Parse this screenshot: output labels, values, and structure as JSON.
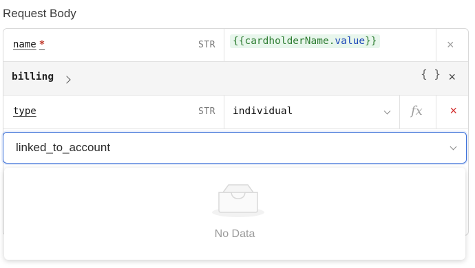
{
  "section": {
    "title": "Request Body"
  },
  "rows": [
    {
      "key": "name",
      "required_mark": "*",
      "type": "STR",
      "value_open": "{{",
      "value_object": "cardholderName",
      "value_dot": ".",
      "value_prop": "value",
      "value_close": "}}",
      "action": "×"
    },
    {
      "key": "billing",
      "braces": "{ }",
      "action": "×"
    },
    {
      "key": "type",
      "type": "STR",
      "selected": "individual",
      "fx": "fx",
      "action": "×"
    }
  ],
  "key_input": {
    "value": "linked_to_account"
  },
  "dropdown": {
    "empty_text": "No Data",
    "icon": "empty-inbox-icon"
  },
  "colors": {
    "accent": "#3a6fd8",
    "expression_text": "#2e7d32",
    "expression_bg": "#e8f6ec",
    "delete": "#d32f2f",
    "required": "#c0392b"
  }
}
